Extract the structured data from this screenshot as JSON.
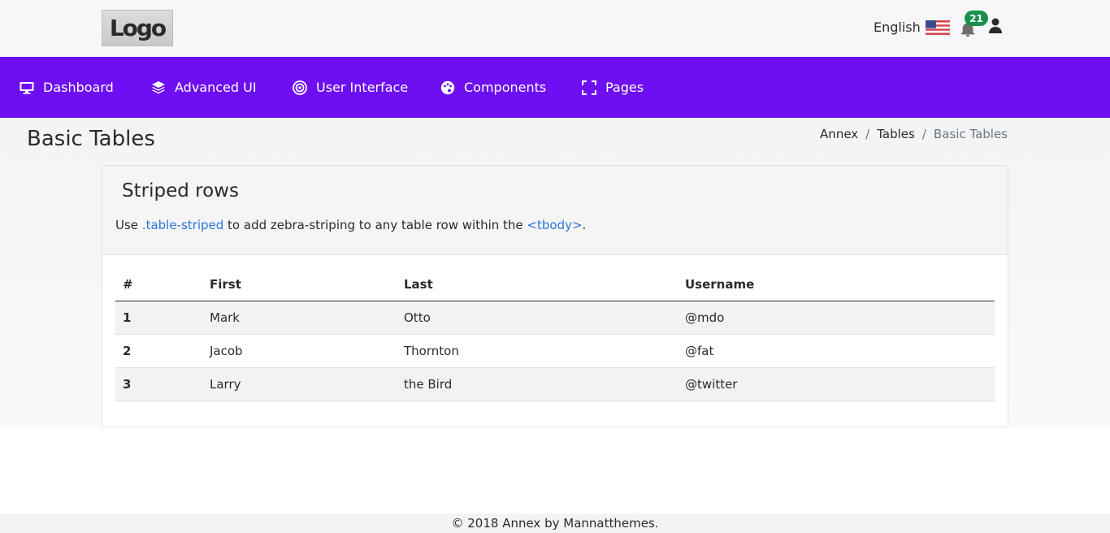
{
  "brand": {
    "logo_text": "Logo"
  },
  "topbar": {
    "language": "English",
    "notification_count": "21"
  },
  "nav": {
    "items": [
      {
        "label": "Dashboard",
        "icon": "monitor-icon"
      },
      {
        "label": "Advanced UI",
        "icon": "layers-icon"
      },
      {
        "label": "User Interface",
        "icon": "target-icon"
      },
      {
        "label": "Components",
        "icon": "palette-icon"
      },
      {
        "label": "Pages",
        "icon": "expand-icon"
      }
    ]
  },
  "page": {
    "title": "Basic Tables",
    "breadcrumb": [
      "Annex",
      "Tables",
      "Basic Tables"
    ]
  },
  "card": {
    "title": "Striped rows",
    "desc_prefix": "Use ",
    "desc_code1": ".table-striped",
    "desc_middle": " to add zebra-striping to any table row within the ",
    "desc_code2": "<tbody>",
    "desc_suffix": "."
  },
  "table": {
    "headers": [
      "#",
      "First",
      "Last",
      "Username"
    ],
    "rows": [
      [
        "1",
        "Mark",
        "Otto",
        "@mdo"
      ],
      [
        "2",
        "Jacob",
        "Thornton",
        "@fat"
      ],
      [
        "3",
        "Larry",
        "the Bird",
        "@twitter"
      ]
    ]
  },
  "footer": {
    "text": "© 2018 Annex by Mannatthemes."
  },
  "colors": {
    "nav_bg": "#6e0ff3",
    "badge_bg": "#18924b",
    "code_link": "#2f73d9"
  }
}
